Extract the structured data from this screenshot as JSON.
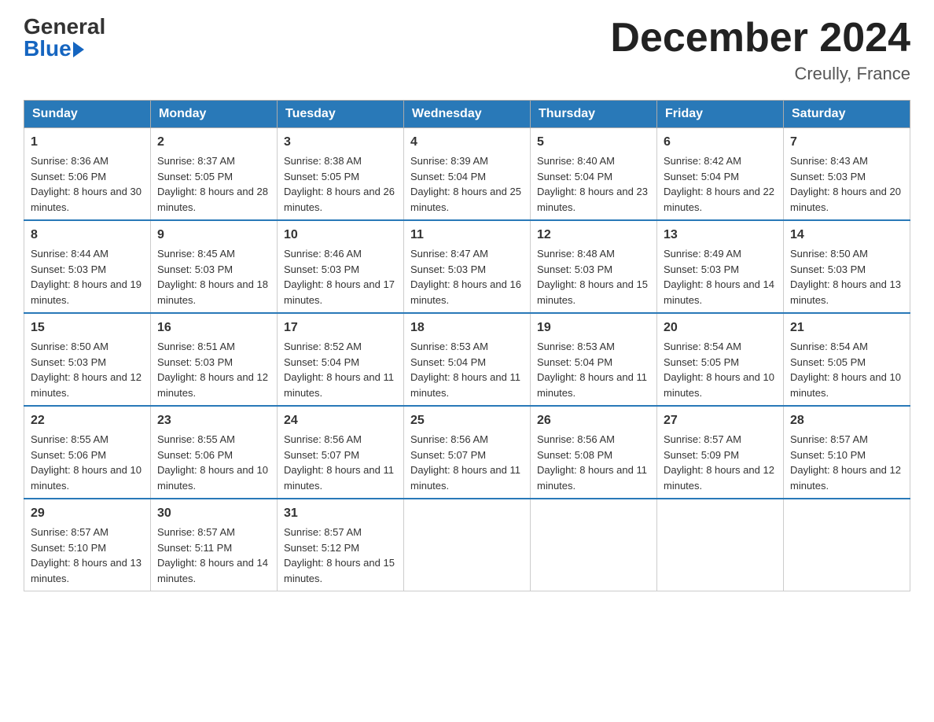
{
  "header": {
    "logo_general": "General",
    "logo_blue": "Blue",
    "month_title": "December 2024",
    "location": "Creully, France"
  },
  "days_of_week": [
    "Sunday",
    "Monday",
    "Tuesday",
    "Wednesday",
    "Thursday",
    "Friday",
    "Saturday"
  ],
  "weeks": [
    [
      {
        "day": "1",
        "sunrise": "8:36 AM",
        "sunset": "5:06 PM",
        "daylight": "8 hours and 30 minutes."
      },
      {
        "day": "2",
        "sunrise": "8:37 AM",
        "sunset": "5:05 PM",
        "daylight": "8 hours and 28 minutes."
      },
      {
        "day": "3",
        "sunrise": "8:38 AM",
        "sunset": "5:05 PM",
        "daylight": "8 hours and 26 minutes."
      },
      {
        "day": "4",
        "sunrise": "8:39 AM",
        "sunset": "5:04 PM",
        "daylight": "8 hours and 25 minutes."
      },
      {
        "day": "5",
        "sunrise": "8:40 AM",
        "sunset": "5:04 PM",
        "daylight": "8 hours and 23 minutes."
      },
      {
        "day": "6",
        "sunrise": "8:42 AM",
        "sunset": "5:04 PM",
        "daylight": "8 hours and 22 minutes."
      },
      {
        "day": "7",
        "sunrise": "8:43 AM",
        "sunset": "5:03 PM",
        "daylight": "8 hours and 20 minutes."
      }
    ],
    [
      {
        "day": "8",
        "sunrise": "8:44 AM",
        "sunset": "5:03 PM",
        "daylight": "8 hours and 19 minutes."
      },
      {
        "day": "9",
        "sunrise": "8:45 AM",
        "sunset": "5:03 PM",
        "daylight": "8 hours and 18 minutes."
      },
      {
        "day": "10",
        "sunrise": "8:46 AM",
        "sunset": "5:03 PM",
        "daylight": "8 hours and 17 minutes."
      },
      {
        "day": "11",
        "sunrise": "8:47 AM",
        "sunset": "5:03 PM",
        "daylight": "8 hours and 16 minutes."
      },
      {
        "day": "12",
        "sunrise": "8:48 AM",
        "sunset": "5:03 PM",
        "daylight": "8 hours and 15 minutes."
      },
      {
        "day": "13",
        "sunrise": "8:49 AM",
        "sunset": "5:03 PM",
        "daylight": "8 hours and 14 minutes."
      },
      {
        "day": "14",
        "sunrise": "8:50 AM",
        "sunset": "5:03 PM",
        "daylight": "8 hours and 13 minutes."
      }
    ],
    [
      {
        "day": "15",
        "sunrise": "8:50 AM",
        "sunset": "5:03 PM",
        "daylight": "8 hours and 12 minutes."
      },
      {
        "day": "16",
        "sunrise": "8:51 AM",
        "sunset": "5:03 PM",
        "daylight": "8 hours and 12 minutes."
      },
      {
        "day": "17",
        "sunrise": "8:52 AM",
        "sunset": "5:04 PM",
        "daylight": "8 hours and 11 minutes."
      },
      {
        "day": "18",
        "sunrise": "8:53 AM",
        "sunset": "5:04 PM",
        "daylight": "8 hours and 11 minutes."
      },
      {
        "day": "19",
        "sunrise": "8:53 AM",
        "sunset": "5:04 PM",
        "daylight": "8 hours and 11 minutes."
      },
      {
        "day": "20",
        "sunrise": "8:54 AM",
        "sunset": "5:05 PM",
        "daylight": "8 hours and 10 minutes."
      },
      {
        "day": "21",
        "sunrise": "8:54 AM",
        "sunset": "5:05 PM",
        "daylight": "8 hours and 10 minutes."
      }
    ],
    [
      {
        "day": "22",
        "sunrise": "8:55 AM",
        "sunset": "5:06 PM",
        "daylight": "8 hours and 10 minutes."
      },
      {
        "day": "23",
        "sunrise": "8:55 AM",
        "sunset": "5:06 PM",
        "daylight": "8 hours and 10 minutes."
      },
      {
        "day": "24",
        "sunrise": "8:56 AM",
        "sunset": "5:07 PM",
        "daylight": "8 hours and 11 minutes."
      },
      {
        "day": "25",
        "sunrise": "8:56 AM",
        "sunset": "5:07 PM",
        "daylight": "8 hours and 11 minutes."
      },
      {
        "day": "26",
        "sunrise": "8:56 AM",
        "sunset": "5:08 PM",
        "daylight": "8 hours and 11 minutes."
      },
      {
        "day": "27",
        "sunrise": "8:57 AM",
        "sunset": "5:09 PM",
        "daylight": "8 hours and 12 minutes."
      },
      {
        "day": "28",
        "sunrise": "8:57 AM",
        "sunset": "5:10 PM",
        "daylight": "8 hours and 12 minutes."
      }
    ],
    [
      {
        "day": "29",
        "sunrise": "8:57 AM",
        "sunset": "5:10 PM",
        "daylight": "8 hours and 13 minutes."
      },
      {
        "day": "30",
        "sunrise": "8:57 AM",
        "sunset": "5:11 PM",
        "daylight": "8 hours and 14 minutes."
      },
      {
        "day": "31",
        "sunrise": "8:57 AM",
        "sunset": "5:12 PM",
        "daylight": "8 hours and 15 minutes."
      },
      null,
      null,
      null,
      null
    ]
  ]
}
